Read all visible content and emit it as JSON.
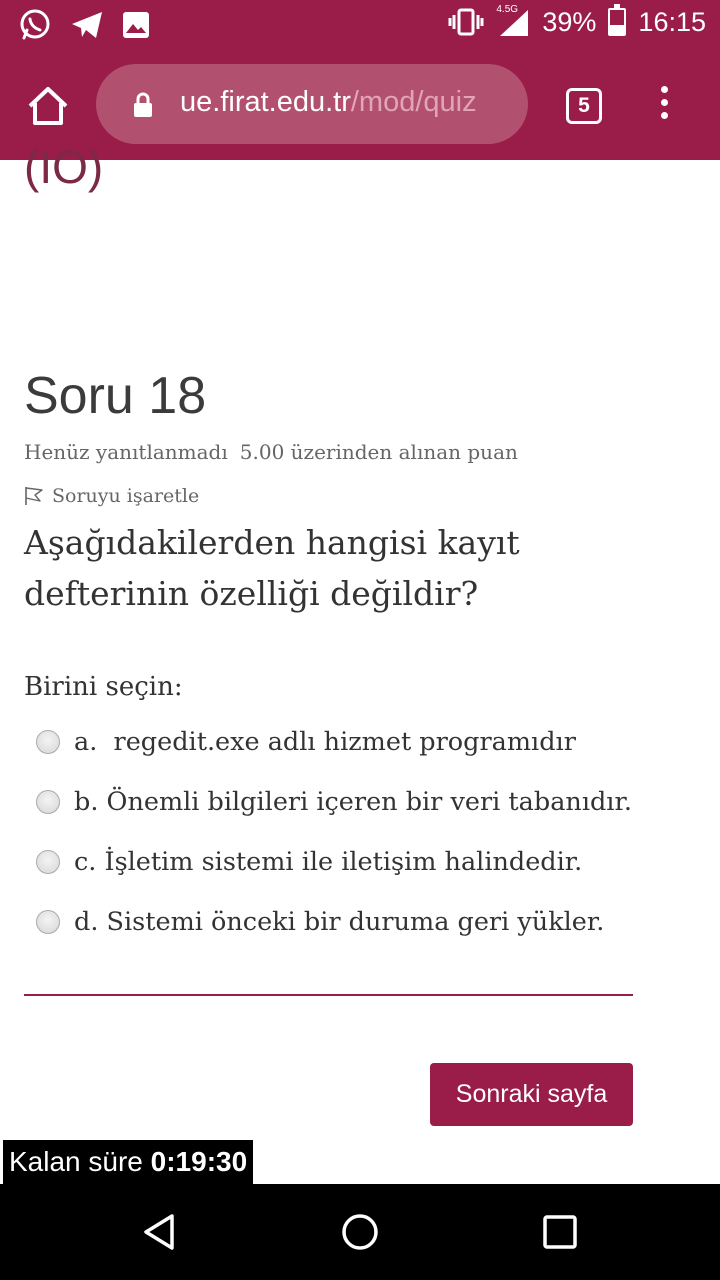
{
  "status_bar": {
    "network_label": "4.5G",
    "battery_percent": "39%",
    "battery_level": 0.39,
    "time": "16:15",
    "icons": [
      "whatsapp-icon",
      "telegram-icon",
      "gallery-icon",
      "vibrate-icon",
      "signal-icon",
      "battery-icon"
    ]
  },
  "browser": {
    "url_domain": "ue.firat.edu.tr",
    "url_path": "/mod/quiz",
    "tab_count": "5"
  },
  "prev_fragment": "(IO)",
  "question": {
    "title": "Soru 18",
    "status": "Henüz yanıtlanmadı",
    "points": "5.00 üzerinden alınan puan",
    "flag_label": "Soruyu işaretle",
    "text": "Aşağıdakilerden hangisi kayıt defterinin özelliği değildir?",
    "prompt": "Birini seçin:",
    "answers": [
      {
        "label": "a.  regedit.exe adlı hizmet programıdır"
      },
      {
        "label": "b. Önemli bilgileri içeren bir veri tabanıdır."
      },
      {
        "label": "c. İşletim sistemi ile iletişim halindedir."
      },
      {
        "label": "d. Sistemi önceki bir duruma geri yükler."
      }
    ]
  },
  "next_button_label": "Sonraki sayfa",
  "timer": {
    "label": "Kalan süre",
    "value": "0:19:30"
  },
  "colors": {
    "brand": "#9a1c48",
    "url_pill": "#b2506f"
  }
}
